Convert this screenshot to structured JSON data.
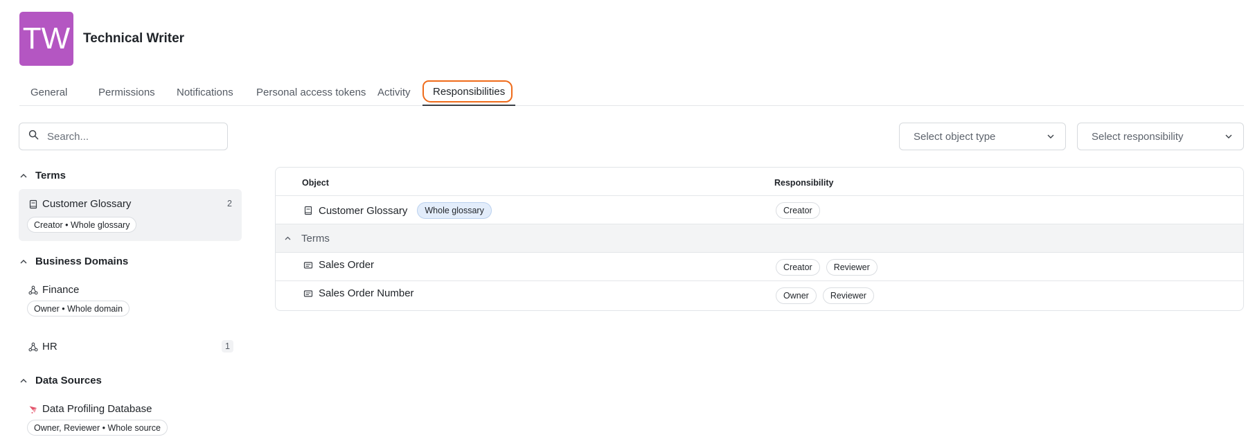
{
  "header": {
    "avatar_initials": "TW",
    "avatar_color": "#b456c2",
    "title": "Technical Writer"
  },
  "tabs": [
    {
      "label": "General"
    },
    {
      "label": "Permissions"
    },
    {
      "label": "Notifications"
    },
    {
      "label": "Personal access tokens"
    },
    {
      "label": "Activity"
    },
    {
      "label": "Responsibilities",
      "active": true
    }
  ],
  "search": {
    "placeholder": "Search..."
  },
  "filters": {
    "object_type_placeholder": "Select object type",
    "responsibility_placeholder": "Select responsibility"
  },
  "sidebar": {
    "sections": [
      {
        "title": "Terms",
        "items": [
          {
            "label": "Customer Glossary",
            "icon": "glossary-icon",
            "count": "2",
            "pill": "Creator • Whole glossary",
            "selected": true
          }
        ]
      },
      {
        "title": "Business Domains",
        "items": [
          {
            "label": "Finance",
            "icon": "domain-icon",
            "pill": "Owner • Whole domain"
          },
          {
            "label": "HR",
            "icon": "domain-icon",
            "count": "1"
          }
        ]
      },
      {
        "title": "Data Sources",
        "items": [
          {
            "label": "Data Profiling Database",
            "icon": "datasource-icon",
            "pill": "Owner, Reviewer • Whole source"
          }
        ]
      }
    ]
  },
  "table": {
    "columns": [
      "Object",
      "Responsibility"
    ],
    "rows": [
      {
        "object": "Customer Glossary",
        "icon": "glossary-icon",
        "badge": "Whole glossary",
        "responsibilities": [
          "Creator"
        ]
      },
      {
        "group": "Terms"
      },
      {
        "object": "Sales Order",
        "icon": "term-icon",
        "responsibilities": [
          "Creator",
          "Reviewer"
        ]
      },
      {
        "object": "Sales Order Number",
        "icon": "term-icon",
        "responsibilities": [
          "Owner",
          "Reviewer"
        ]
      }
    ]
  },
  "colors": {
    "accent_highlight": "#ef6b1a",
    "badge_blue": "#e3edfb"
  }
}
